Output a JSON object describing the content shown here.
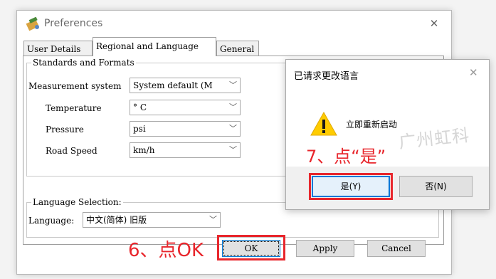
{
  "preferences": {
    "title": "Preferences",
    "close_glyph": "✕",
    "tabs": [
      "User Details",
      "Regional and Language",
      "General"
    ],
    "standards": {
      "legend": "Standards and Formats",
      "measurement_label": "Measurement system",
      "measurement_value": "System default (M",
      "temperature_label": "Temperature",
      "temperature_value": "° C",
      "pressure_label": "Pressure",
      "pressure_value": "psi",
      "road_speed_label": "Road Speed",
      "road_speed_value": "km/h"
    },
    "language_selection": {
      "legend": "Language Selection:",
      "language_label": "Language:",
      "language_value": "中文(简体) 旧版"
    },
    "buttons": {
      "ok": "OK",
      "apply": "Apply",
      "cancel": "Cancel"
    }
  },
  "dialog": {
    "title": "已请求更改语言",
    "close_glyph": "✕",
    "message": "立即重新启动",
    "yes_label": "是(Y)",
    "no_label": "否(N)"
  },
  "annotations": {
    "step6": "6、点OK",
    "step7": "7、点“是”",
    "watermark": "广州虹科"
  },
  "icons": {
    "app_icon": "preferences-app-icon",
    "warning_icon": "warning-icon",
    "chevron": "chevron-down-icon"
  },
  "colors": {
    "annotation_red": "#e8262c",
    "focus_blue": "#0078d7",
    "warning_yellow": "#ffcc00"
  }
}
